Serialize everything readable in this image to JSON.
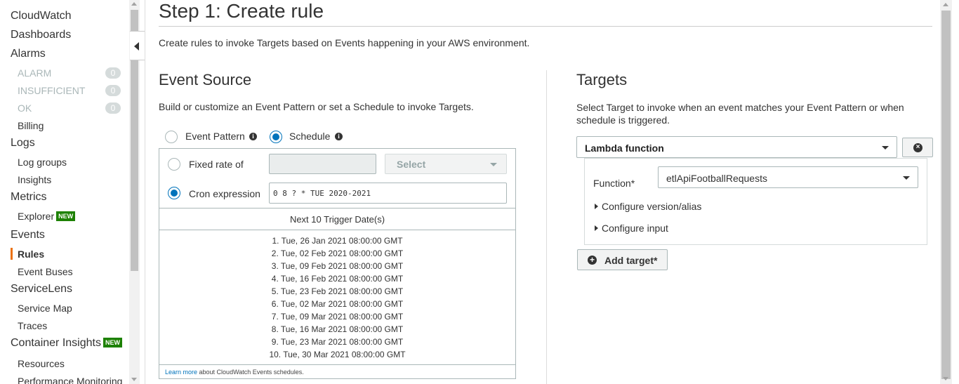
{
  "sidebar": {
    "cloudwatch": "CloudWatch",
    "dashboards": "Dashboards",
    "alarms": "Alarms",
    "alarm_items": [
      {
        "label": "ALARM",
        "count": "0"
      },
      {
        "label": "INSUFFICIENT",
        "count": "0"
      },
      {
        "label": "OK",
        "count": "0"
      }
    ],
    "billing": "Billing",
    "logs": "Logs",
    "log_groups": "Log groups",
    "insights": "Insights",
    "metrics": "Metrics",
    "explorer": "Explorer",
    "new_badge": "NEW",
    "events": "Events",
    "rules": "Rules",
    "event_buses": "Event Buses",
    "servicelens": "ServiceLens",
    "service_map": "Service Map",
    "traces": "Traces",
    "container_insights": "Container Insights",
    "resources": "Resources",
    "performance_monitoring": "Performance Monitoring",
    "active_color": "#ec7211"
  },
  "page": {
    "title": "Step 1: Create rule",
    "intro": "Create rules to invoke Targets based on Events happening in your AWS environment."
  },
  "event_source": {
    "heading": "Event Source",
    "description": "Build or customize an Event Pattern or set a Schedule to invoke Targets.",
    "option_event_pattern": "Event Pattern",
    "option_schedule": "Schedule",
    "selected_option": "Schedule",
    "fixed_rate_label": "Fixed rate of",
    "fixed_rate_value": "",
    "unit_select": "Select",
    "cron_label": "Cron expression",
    "cron_value": "0 8 ? * TUE 2020-2021",
    "next_header": "Next 10 Trigger Date(s)",
    "dates": [
      "1. Tue, 26 Jan 2021 08:00:00 GMT",
      "2. Tue, 02 Feb 2021 08:00:00 GMT",
      "3. Tue, 09 Feb 2021 08:00:00 GMT",
      "4. Tue, 16 Feb 2021 08:00:00 GMT",
      "5. Tue, 23 Feb 2021 08:00:00 GMT",
      "6. Tue, 02 Mar 2021 08:00:00 GMT",
      "7. Tue, 09 Mar 2021 08:00:00 GMT",
      "8. Tue, 16 Mar 2021 08:00:00 GMT",
      "9. Tue, 23 Mar 2021 08:00:00 GMT",
      "10. Tue, 30 Mar 2021 08:00:00 GMT"
    ],
    "learn_more_link": "Learn more",
    "learn_more_text": " about CloudWatch Events schedules."
  },
  "targets": {
    "heading": "Targets",
    "description": "Select Target to invoke when an event matches your Event Pattern or when schedule is triggered.",
    "target_type": "Lambda function",
    "function_label": "Function*",
    "function_value": "etlApiFootballRequests",
    "configure_version": "Configure version/alias",
    "configure_input": "Configure input",
    "add_target": "Add target*"
  },
  "colors": {
    "accent": "#0073bb",
    "new_badge": "#1d8102"
  }
}
